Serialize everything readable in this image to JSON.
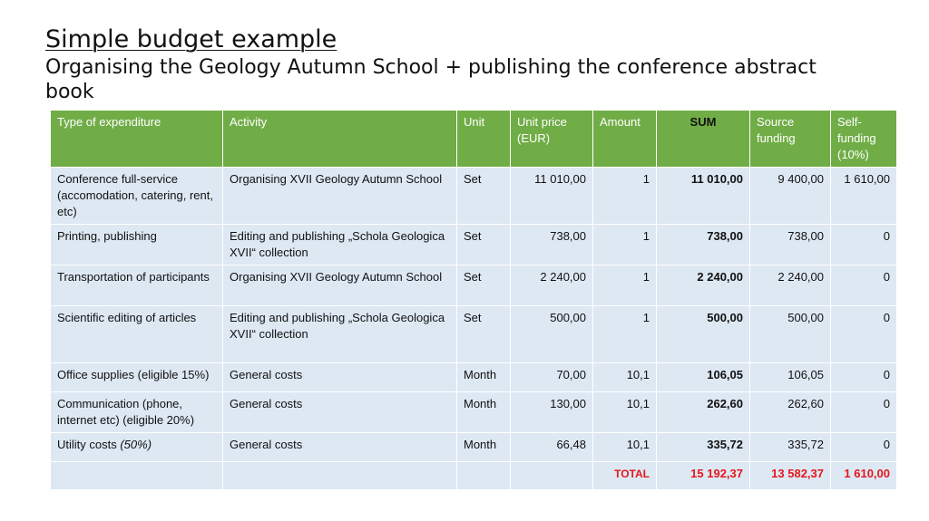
{
  "slide": {
    "title": "Simple budget example",
    "subtitle": "Organising the Geology Autumn School + publishing the conference abstract book"
  },
  "table": {
    "headers": {
      "type": "Type of expenditure",
      "activity": "Activity",
      "unit": "Unit",
      "unit_price": "Unit price (EUR)",
      "amount": "Amount",
      "sum": "SUM",
      "source_funding": "Source funding",
      "self_funding": "Self-funding (10%)"
    },
    "rows": [
      {
        "type": "Conference full-service (accomodation, catering, rent, etc)",
        "type_note": "",
        "activity": "Organising XVII Geology Autumn School",
        "unit": "Set",
        "unit_price": "11 010,00",
        "amount": "1",
        "sum": "11 010,00",
        "source": "9 400,00",
        "self": "1 610,00"
      },
      {
        "type": "Printing, publishing",
        "type_note": "",
        "activity": "Editing and publishing „Schola Geologica XVII“ collection",
        "unit": "Set",
        "unit_price": "738,00",
        "amount": "1",
        "sum": "738,00",
        "source": "738,00",
        "self": "0"
      },
      {
        "type": "Transportation of participants",
        "type_note": "",
        "activity": "Organising XVII Geology Autumn School",
        "unit": "Set",
        "unit_price": "2 240,00",
        "amount": "1",
        "sum": "2 240,00",
        "source": "2 240,00",
        "self": "0"
      },
      {
        "type": "Scientific editing of articles",
        "type_note": "",
        "activity": "Editing and publishing „Schola Geologica XVII“ collection",
        "unit": "Set",
        "unit_price": "500,00",
        "amount": "1",
        "sum": "500,00",
        "source": "500,00",
        "self": "0"
      },
      {
        "type": "Office supplies (eligible 15%)",
        "type_note": "",
        "activity": "General costs",
        "unit": "Month",
        "unit_price": "70,00",
        "amount": "10,1",
        "sum": "106,05",
        "source": "106,05",
        "self": "0"
      },
      {
        "type": "Communication (phone, internet etc) (eligible 20%)",
        "type_note": "",
        "activity": "General costs",
        "unit": "Month",
        "unit_price": "130,00",
        "amount": "10,1",
        "sum": "262,60",
        "source": "262,60",
        "self": "0"
      },
      {
        "type": "Utility costs ",
        "type_note": "(50%)",
        "activity": "General costs",
        "unit": "Month",
        "unit_price": "66,48",
        "amount": "10,1",
        "sum": "335,72",
        "source": "335,72",
        "self": "0"
      }
    ],
    "total": {
      "label": "TOTAL",
      "sum": "15 192,37",
      "source": "13 582,37",
      "self": "1 610,00"
    }
  },
  "colors": {
    "header_bg": "#71ad47",
    "body_bg": "#dde8f3",
    "total_text": "#e3171d"
  }
}
